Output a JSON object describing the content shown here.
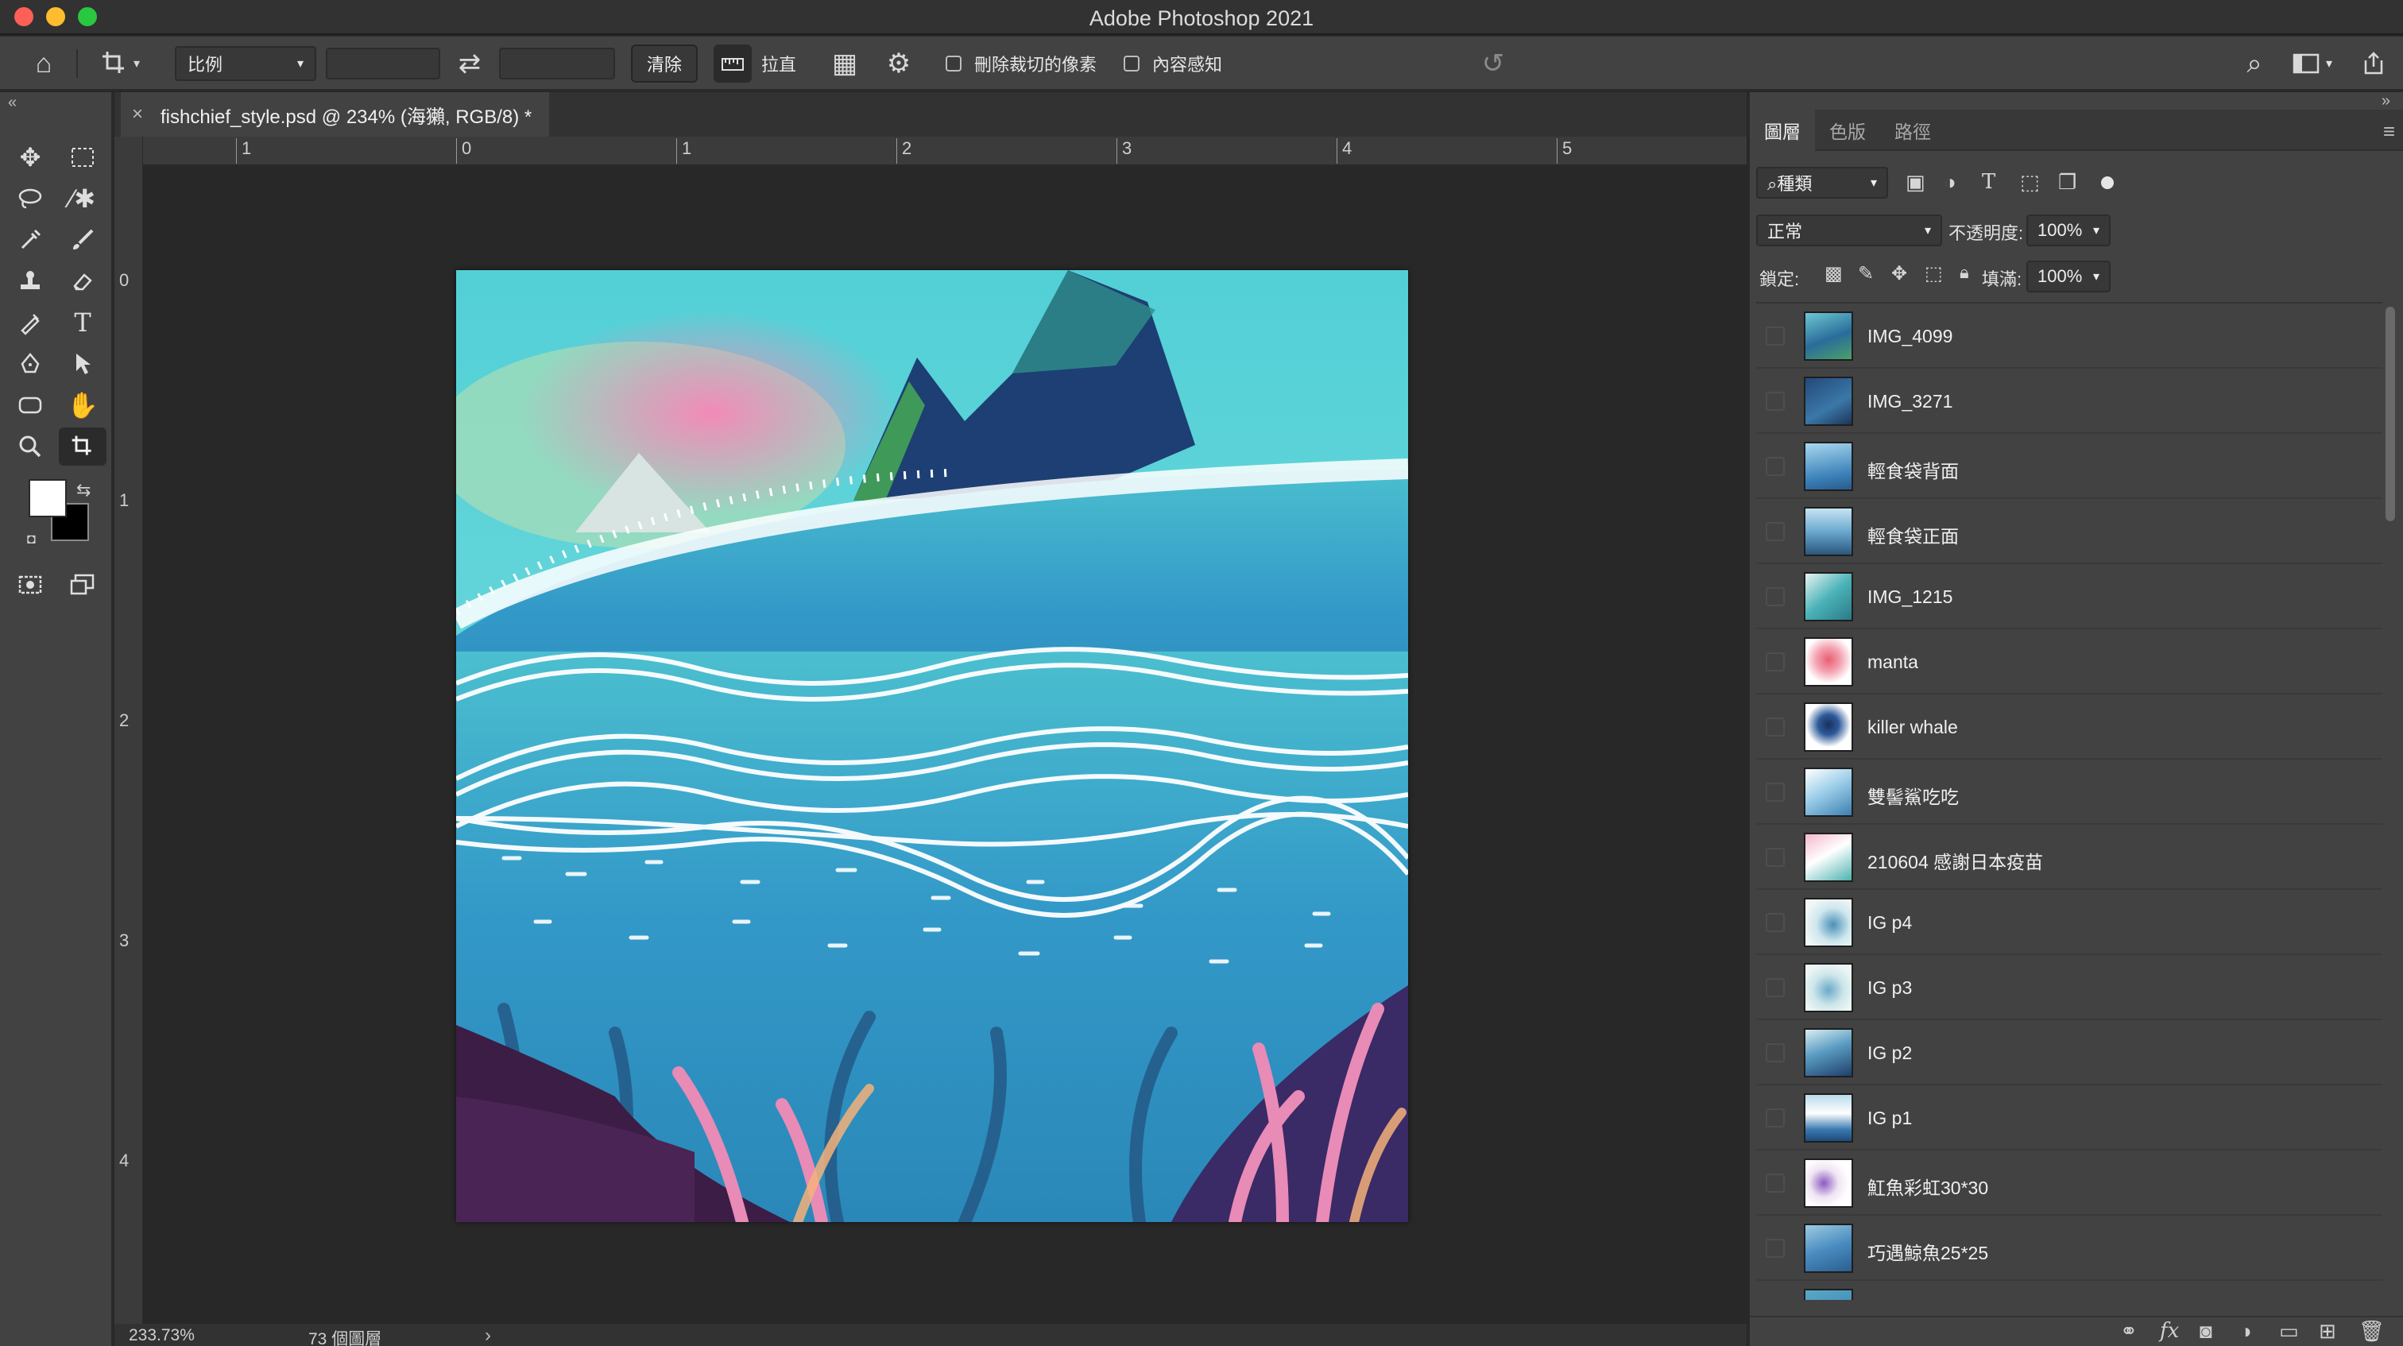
{
  "window": {
    "title": "Adobe Photoshop 2021"
  },
  "options_bar": {
    "ratio_label": "比例",
    "clear_label": "清除",
    "straighten_label": "拉直",
    "delete_cropped_label": "刪除裁切的像素",
    "content_aware_label": "內容感知"
  },
  "document": {
    "tab_title": "fishchief_style.psd @ 234% (海獺, RGB/8) *",
    "ruler_h": [
      "1",
      "0",
      "1",
      "2",
      "3",
      "4",
      "5"
    ],
    "ruler_v": [
      "0",
      "1",
      "2",
      "3",
      "4"
    ]
  },
  "status": {
    "zoom": "233.73%",
    "info": "73 個圖層"
  },
  "layers_panel": {
    "tabs": [
      "圖層",
      "色版",
      "路徑"
    ],
    "filter_label": "種類",
    "blend_mode": "正常",
    "opacity_label": "不透明度:",
    "opacity_value": "100%",
    "lock_label": "鎖定:",
    "fill_label": "填滿:",
    "fill_value": "100%",
    "layers": [
      "IMG_4099",
      "IMG_3271",
      "輕食袋背面",
      "輕食袋正面",
      "IMG_1215",
      "manta",
      "killer whale",
      "雙髻鯊吃吃",
      "210604 感謝日本疫苗",
      "IG p4",
      "IG p3",
      "IG p2",
      "IG p1",
      "魟魚彩虹30*30",
      "巧遇鯨魚25*25"
    ]
  },
  "colors": {
    "chrome_bg": "#424242",
    "canvas_bg": "#282828",
    "foreground": "#ffffff",
    "background": "#000000"
  }
}
